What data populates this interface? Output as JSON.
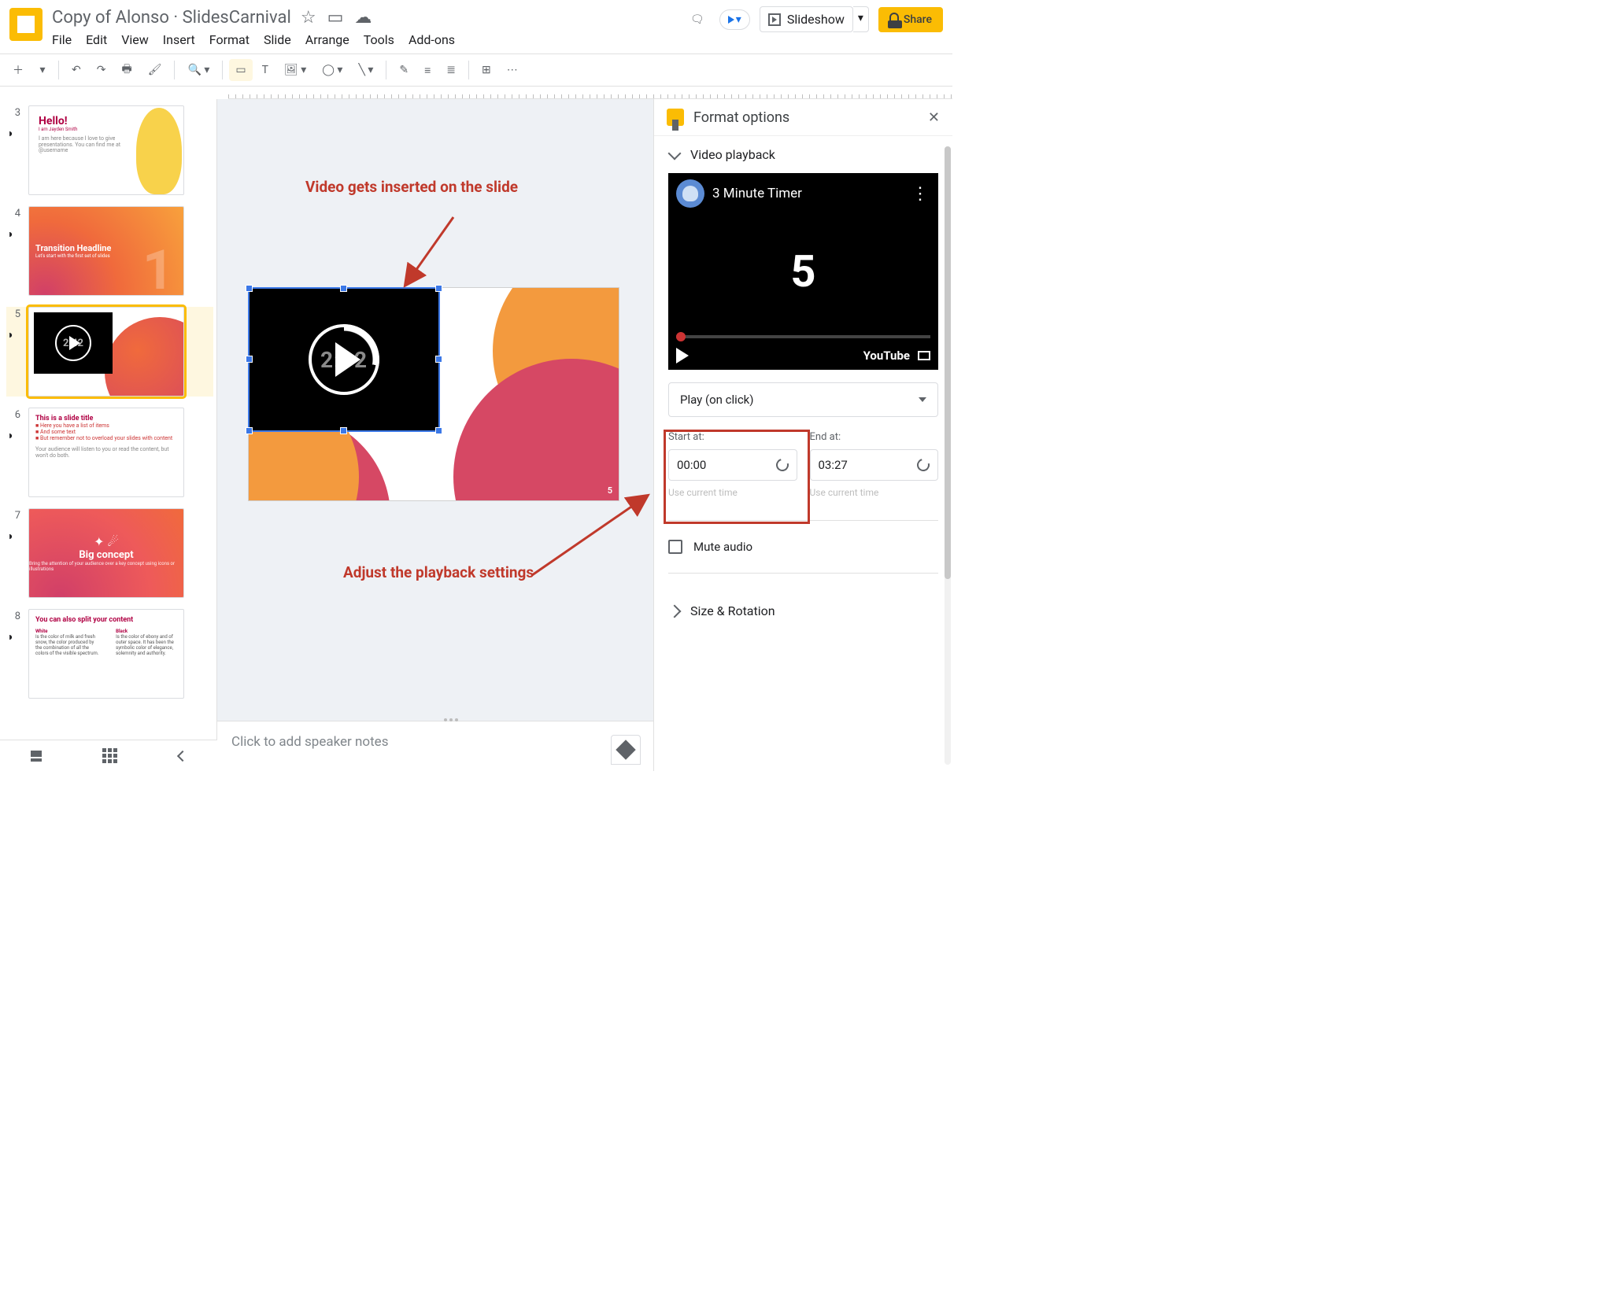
{
  "doc_title": "Copy of Alonso · SlidesCarnival",
  "menus": [
    "File",
    "Edit",
    "View",
    "Insert",
    "Format",
    "Slide",
    "Arrange",
    "Tools",
    "Add-ons"
  ],
  "top": {
    "slideshow": "Slideshow",
    "share": "Share"
  },
  "thumbs": [
    {
      "n": "3",
      "title": "Hello!",
      "sub": "I am Jayden Smith",
      "body": "I am here because I love to give presentations. You can find me at @username"
    },
    {
      "n": "4",
      "title": "Transition Headline",
      "sub": "Let's start with the first set of slides"
    },
    {
      "n": "5",
      "time": "2:42"
    },
    {
      "n": "6",
      "title": "This is a slide title",
      "b1": "Here you have a list of items",
      "b2": "And some text",
      "b3": "But remember not to overload your slides with content",
      "foot": "Your audience will listen to you or read the content, but won't do both."
    },
    {
      "n": "7",
      "title": "Big concept",
      "sub": "Bring the attention of your audience over a key concept using icons or illustrations"
    },
    {
      "n": "8",
      "title": "You can also split your content",
      "l": "White",
      "r": "Black"
    }
  ],
  "canvas": {
    "page_num": "5"
  },
  "annotations": {
    "a1": "Video gets inserted on the slide",
    "a2": "Adjust the playback settings"
  },
  "notes_placeholder": "Click to add speaker notes",
  "panel": {
    "title": "Format options",
    "section1": "Video playback",
    "video_title": "3 Minute Timer",
    "big_number": "5",
    "youtube": "YouTube",
    "play_mode": "Play (on click)",
    "start_label": "Start at:",
    "start_val": "00:00",
    "end_label": "End at:",
    "end_val": "03:27",
    "use_current": "Use current time",
    "mute": "Mute audio",
    "section2": "Size & Rotation"
  }
}
